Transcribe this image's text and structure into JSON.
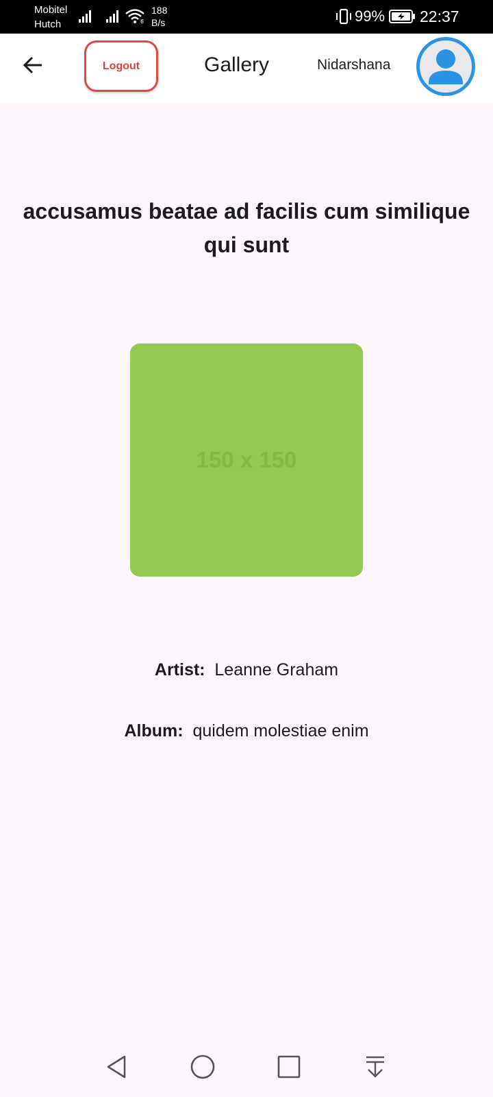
{
  "status_bar": {
    "carrier_1": "Mobitel",
    "carrier_2": "Hutch",
    "net_speed_value": "188",
    "net_speed_unit": "B/s",
    "battery_percent": "99%",
    "time": "22:37",
    "icons": [
      "signal-icon",
      "signal-icon",
      "wifi-icon",
      "vibrate-icon",
      "battery-charging-icon"
    ]
  },
  "app_bar": {
    "back_icon": "arrow-left-icon",
    "logout_label": "Logout",
    "title": "Gallery",
    "username": "Nidarshana",
    "avatar_icon": "person-icon",
    "colors": {
      "logout_border": "#e04a3e",
      "avatar_accent": "#2a93e3"
    }
  },
  "photo": {
    "title": "accusamus beatae ad facilis cum similique qui sunt",
    "placeholder_text": "150 x 150",
    "thumbnail_color": "#92c952",
    "artist_label": "Artist:",
    "artist_value": "Leanne Graham",
    "album_label": "Album:",
    "album_value": "quidem molestiae enim"
  },
  "nav_bar": {
    "icons": [
      "back-triangle-icon",
      "home-circle-icon",
      "recents-square-icon",
      "notification-pull-icon"
    ]
  }
}
